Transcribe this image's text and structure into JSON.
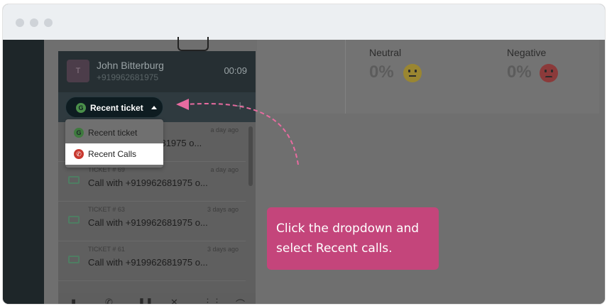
{
  "window": {
    "traffic_lights": [
      "close",
      "minimize",
      "maximize"
    ]
  },
  "sentiment": {
    "neutral": {
      "label": "Neutral",
      "value": "0%"
    },
    "negative": {
      "label": "Negative",
      "value": "0%"
    }
  },
  "call": {
    "avatar_initial": "T",
    "caller_name": "John Bitterburg",
    "caller_number": "+919962681975",
    "timer": "00:09"
  },
  "dropdown": {
    "selected_label": "Recent ticket",
    "options": [
      {
        "label": "Recent ticket"
      },
      {
        "label": "Recent Calls"
      }
    ]
  },
  "tickets": [
    {
      "number": "",
      "date": "a day ago",
      "title": "2681975 o..."
    },
    {
      "number": "TICKET # 69",
      "date": "a day ago",
      "title": "Call with +919962681975 o..."
    },
    {
      "number": "TICKET # 63",
      "date": "3 days ago",
      "title": "Call with +919962681975 o..."
    },
    {
      "number": "TICKET # 61",
      "date": "3 days ago",
      "title": "Call with +919962681975 o..."
    }
  ],
  "callout": {
    "text": "Click the dropdown and select Recent calls."
  },
  "colors": {
    "callout": "#c4457b",
    "arrow": "#e86ba0",
    "rail": "#1e2629"
  }
}
